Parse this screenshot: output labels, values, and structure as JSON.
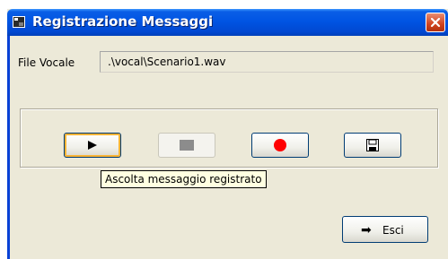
{
  "window": {
    "title": "Registrazione Messaggi"
  },
  "file": {
    "label": "File Vocale",
    "value": ".\\vocal\\Scenario1.wav"
  },
  "controls": {
    "play_icon": "play-icon",
    "stop_icon": "stop-icon",
    "record_icon": "record-icon",
    "save_icon": "save-icon",
    "record_color": "#ff0000"
  },
  "tooltip": {
    "text": "Ascolta messaggio registrato"
  },
  "exit": {
    "arrow": "➡",
    "label": "Esci"
  }
}
